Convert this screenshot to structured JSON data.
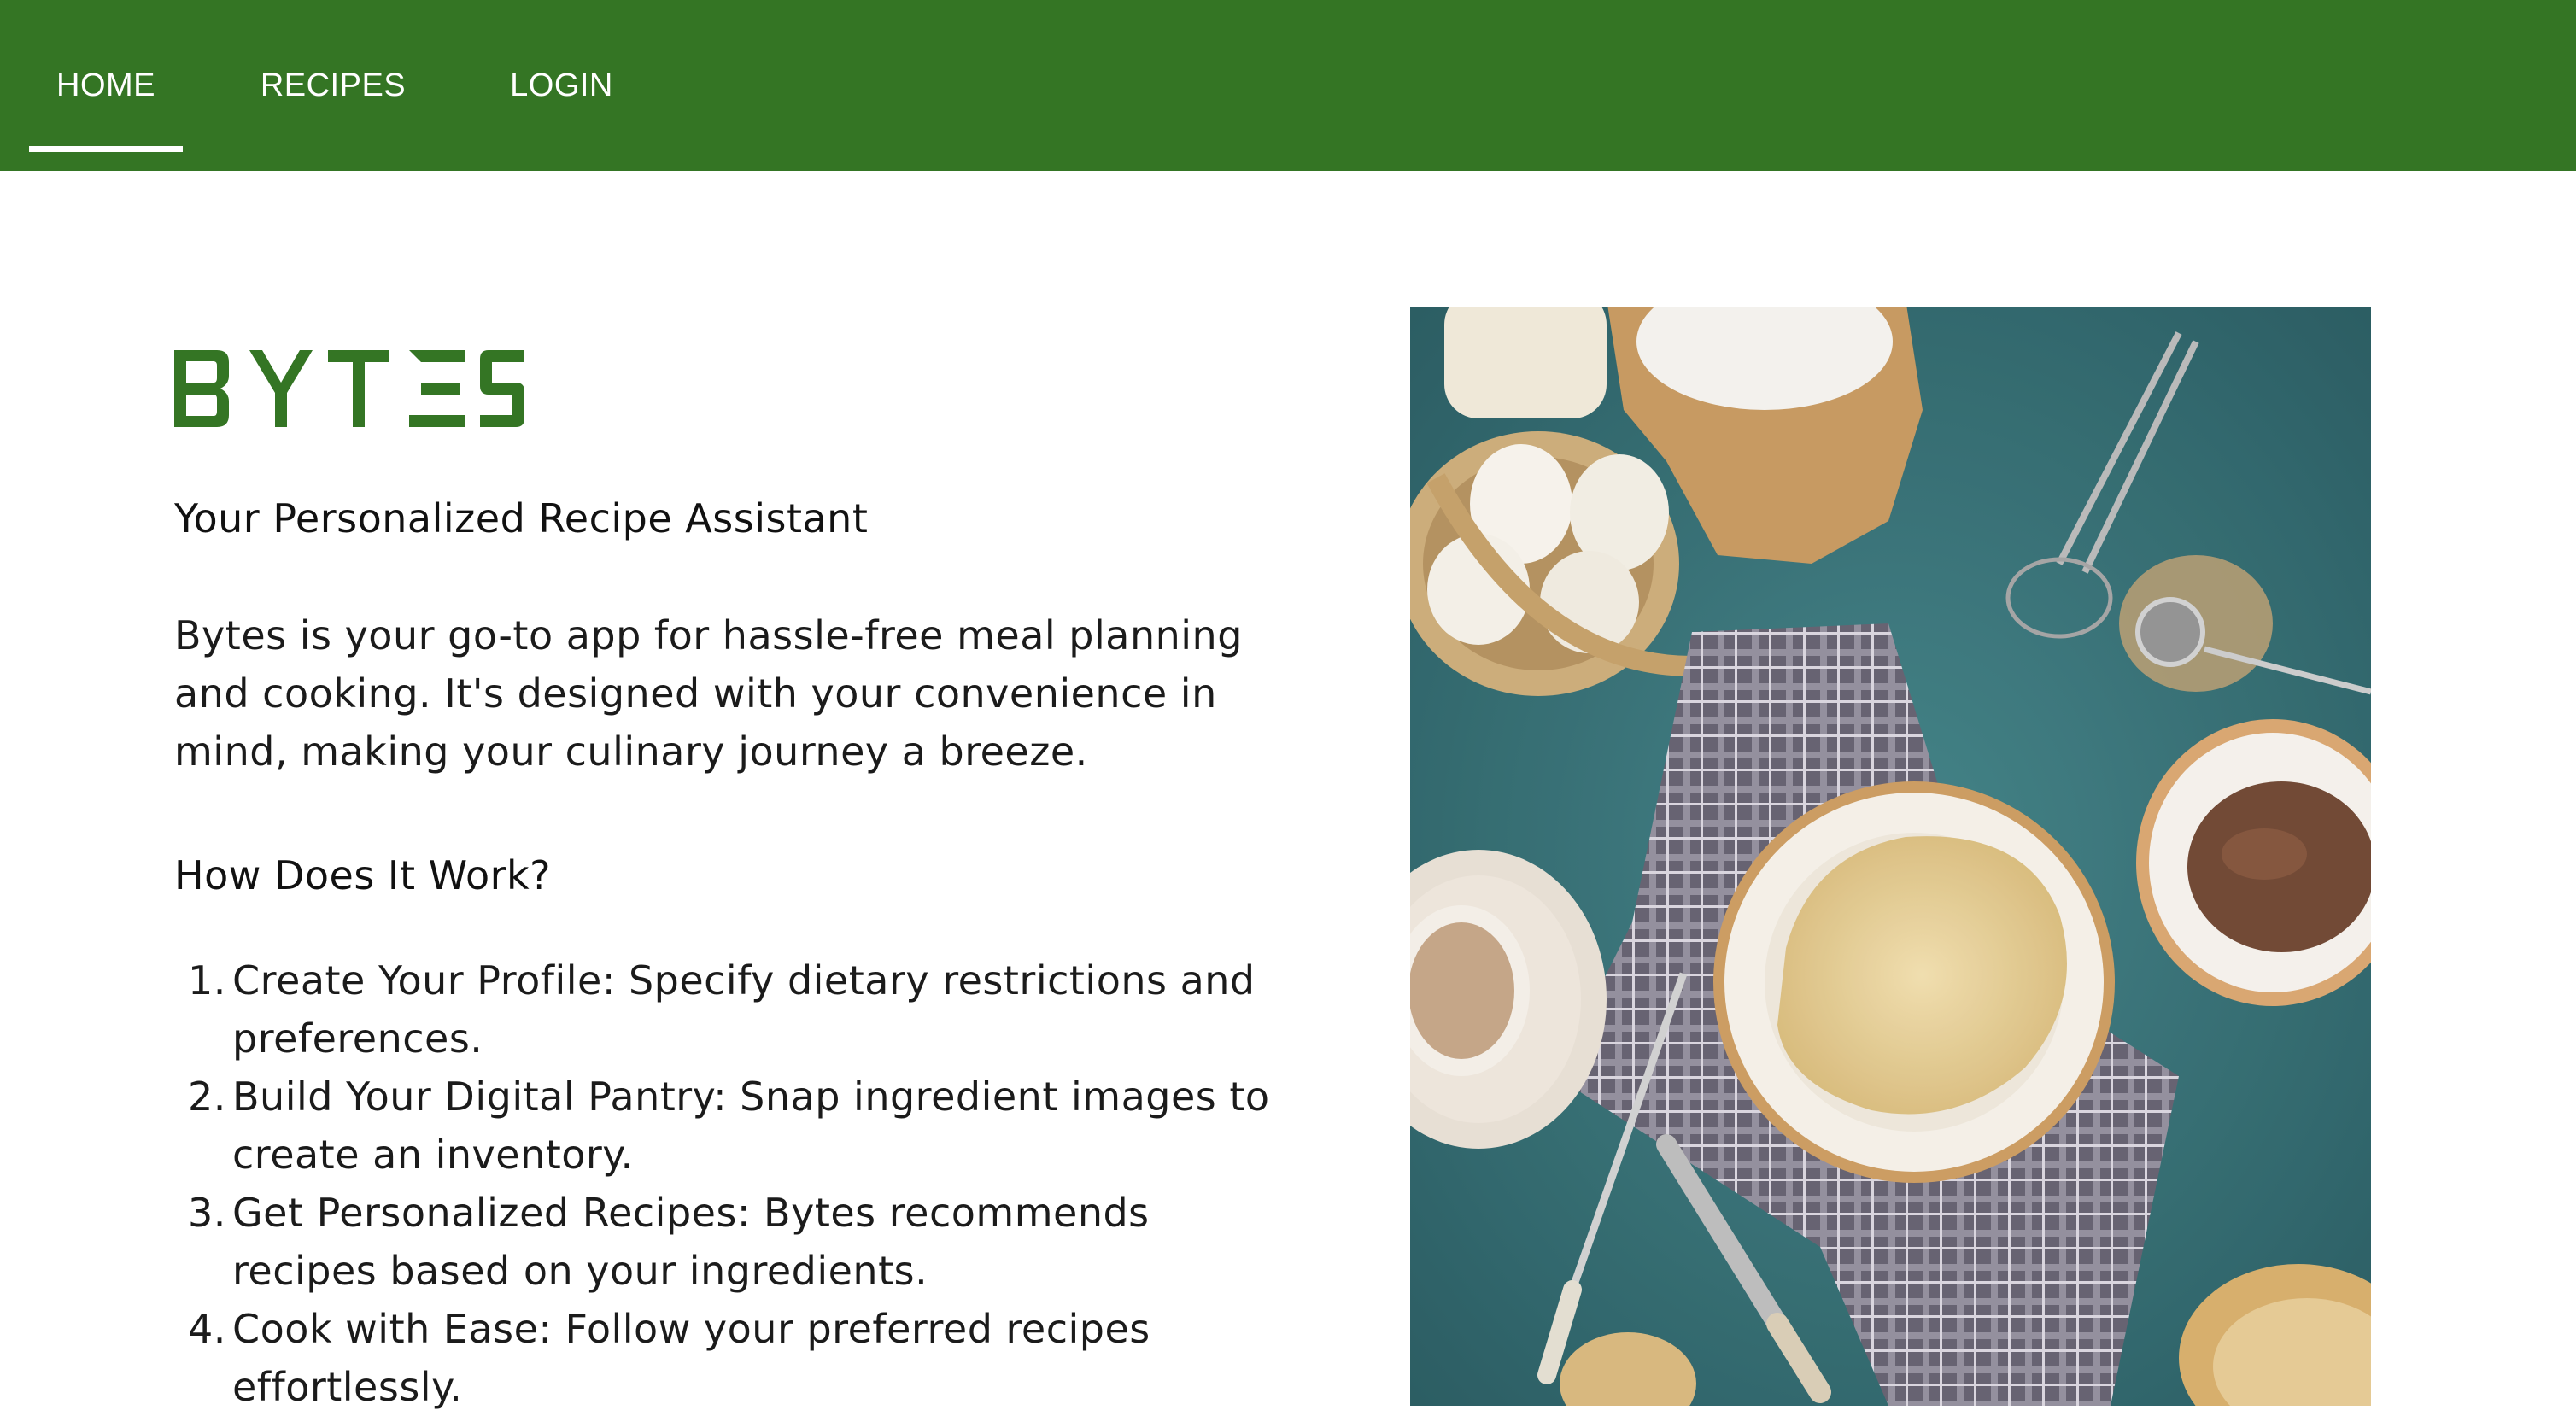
{
  "nav": {
    "tabs": [
      {
        "label": "HOME",
        "active": true
      },
      {
        "label": "RECIPES",
        "active": false
      },
      {
        "label": "LOGIN",
        "active": false
      }
    ],
    "background_color": "#347524",
    "indicator_color": "#ffffff"
  },
  "hero": {
    "logo_text": "BYTES",
    "logo_color": "#347524",
    "tagline": "Your Personalized Recipe Assistant",
    "intro": "Bytes is your go-to app for hassle-free meal planning and cooking. It's designed with your convenience in mind, making your culinary journey a breeze.",
    "how_heading": "How Does It Work?",
    "steps": [
      {
        "num": "1.",
        "text": "Create Your Profile: Specify dietary restrictions and preferences."
      },
      {
        "num": "2.",
        "text": "Build Your Digital Pantry: Snap ingredient images to create an inventory."
      },
      {
        "num": "3.",
        "text": "Get Personalized Recipes: Bytes recommends recipes based on your ingredients."
      },
      {
        "num": "4.",
        "text": "Cook with Ease: Follow your preferred recipes effortlessly."
      }
    ]
  },
  "image": {
    "description_icon": "food-photo",
    "colors": {
      "tabletop": "#2c6a70",
      "cloth": "#6e6a78",
      "plate": "#f4efe6",
      "crepe": "#e6cf98",
      "chocolate": "#6a3f2a"
    }
  }
}
